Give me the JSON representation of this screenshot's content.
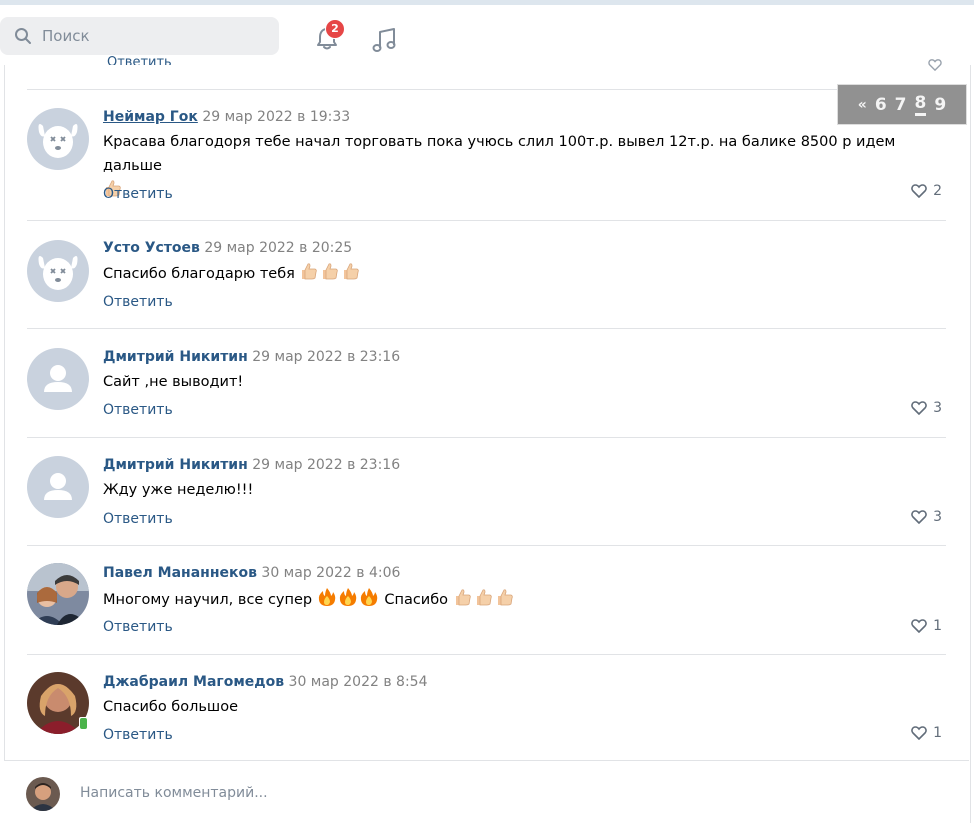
{
  "header": {
    "search_placeholder": "Поиск",
    "notifications_count": "2"
  },
  "prev_comment": {
    "reply_label": "Ответить"
  },
  "pagination": {
    "prev": "«",
    "pages": [
      "6",
      "7",
      "8",
      "9"
    ],
    "current": "8"
  },
  "comments": [
    {
      "author": "Неймар Гок",
      "date": "29 мар 2022 в 19:33",
      "text": "Красава благодоря тебе начал торговать пока учюсь слил 100т.р. вывел 12т.р. на балике 8500 р идем дальше",
      "reply_label": "Ответить",
      "likes": "2",
      "avatar": "deactivated-dog"
    },
    {
      "author": "Усто Устоев",
      "date": "29 мар 2022 в 20:25",
      "text": "Спасибо благодарю тебя",
      "reply_label": "Ответить",
      "likes": "",
      "avatar": "deactivated-dog"
    },
    {
      "author": "Дмитрий Никитин",
      "date": "29 мар 2022 в 23:16",
      "text": "Сайт ,не выводит!",
      "reply_label": "Ответить",
      "likes": "3",
      "avatar": "default-user"
    },
    {
      "author": "Дмитрий Никитин",
      "date": "29 мар 2022 в 23:16",
      "text": "Жду уже неделю!!!",
      "reply_label": "Ответить",
      "likes": "3",
      "avatar": "default-user"
    },
    {
      "author": "Павел Мананнеков",
      "date": "30 мар 2022 в 4:06",
      "text_before": "Многому научил, все супер",
      "text_after": "Спасибо",
      "reply_label": "Ответить",
      "likes": "1",
      "avatar": "photo"
    },
    {
      "author": "Джабраил Магомедов",
      "date": "30 мар 2022 в 8:54",
      "text": "Спасибо большое",
      "reply_label": "Ответить",
      "likes": "1",
      "avatar": "photo"
    }
  ],
  "compose": {
    "placeholder": "Написать комментарий..."
  },
  "colors": {
    "link": "#2a5885",
    "date": "#828282",
    "badge": "#e64646",
    "separator": "#e1e3e6"
  }
}
